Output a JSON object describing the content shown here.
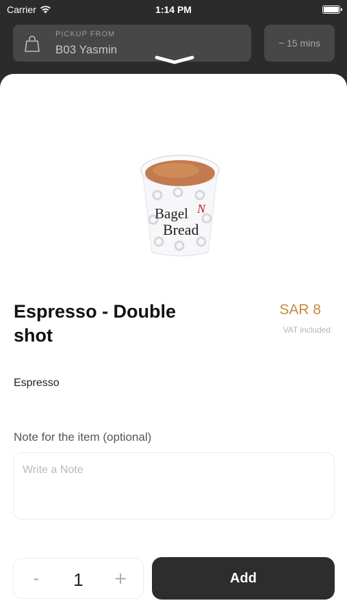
{
  "status_bar": {
    "carrier": "Carrier",
    "time": "1:14 PM"
  },
  "header": {
    "pickup_label": "PICKUP FROM",
    "pickup_location": "B03 Yasmin",
    "eta": "~ 15 mins"
  },
  "product": {
    "title": "Espresso - Double shot",
    "price": "SAR 8",
    "vat_note": "VAT included",
    "description": "Espresso",
    "image_brand_text": "Bagel Bread"
  },
  "note": {
    "label": "Note for the item (optional)",
    "placeholder": "Write a Note",
    "value": ""
  },
  "quantity": {
    "minus": "-",
    "value": "1",
    "plus": "+"
  },
  "actions": {
    "add_label": "Add"
  },
  "colors": {
    "accent_price": "#c68a3b",
    "dark": "#2d2d2d"
  },
  "icons": [
    "wifi-icon",
    "battery-icon",
    "shopping-bag-icon",
    "chevron-down-icon"
  ]
}
